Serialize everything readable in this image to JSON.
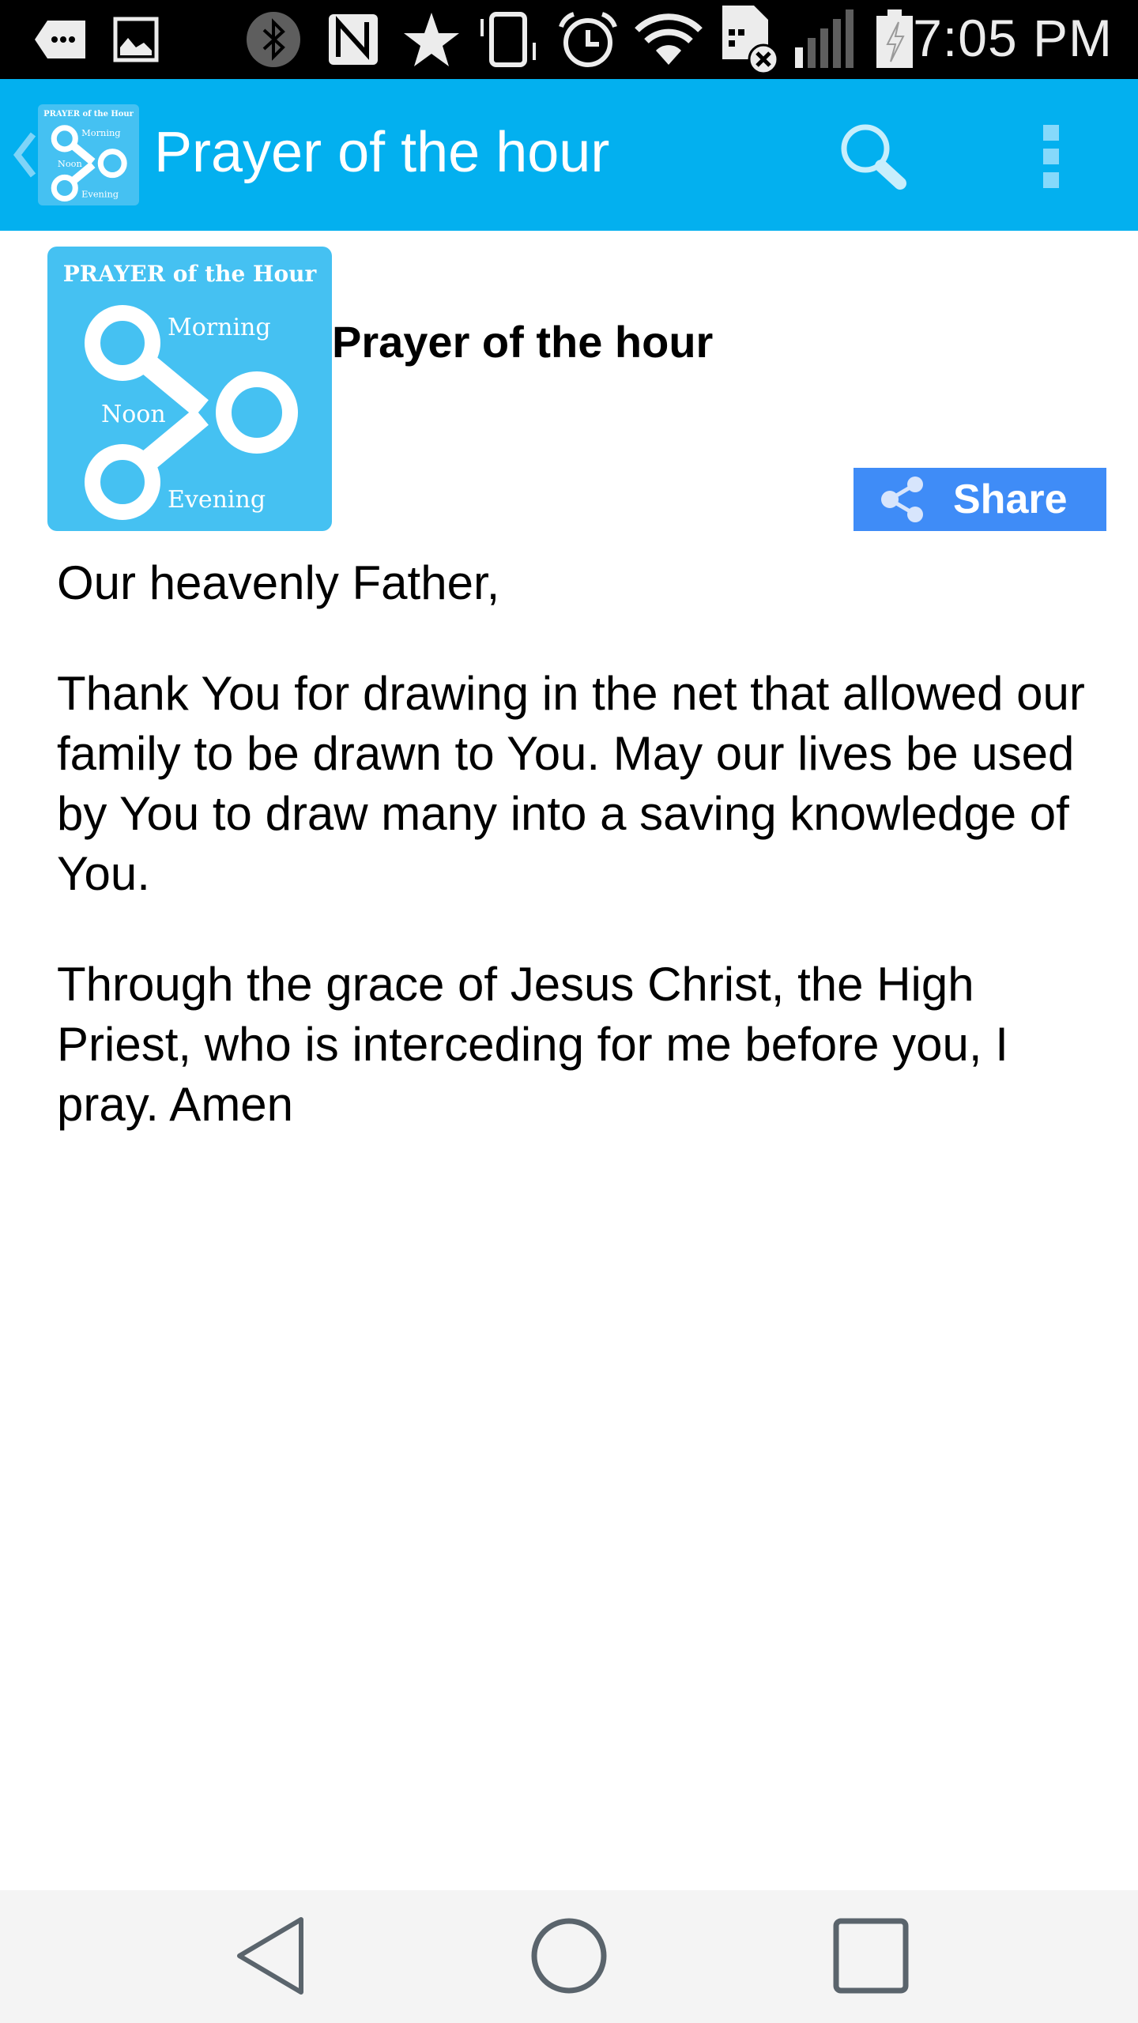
{
  "status_bar": {
    "time": "7:05 PM",
    "icons": [
      "message-icon",
      "image-icon",
      "bluetooth-icon",
      "nfc-icon",
      "star-icon",
      "vibrate-icon",
      "alarm-icon",
      "wifi-icon",
      "no-sim-icon",
      "signal-icon",
      "battery-charging-icon"
    ]
  },
  "app_bar": {
    "title": "Prayer of the hour",
    "back_icon": "chevron-left-icon",
    "search_icon": "search-icon",
    "overflow_icon": "more-vert-icon"
  },
  "logo": {
    "title": "PRAYER of the Hour",
    "labels": [
      "Morning",
      "Noon",
      "Evening"
    ]
  },
  "content": {
    "heading": "Prayer of the hour",
    "share_label": "Share",
    "paragraphs": [
      "Our heavenly Father,",
      "Thank You for drawing in the net that allowed our family to be drawn to You. May our lives be used by You to draw many into a saving knowledge of You.",
      "Through the grace of Jesus Christ, the High Priest, who is interceding for me before you, I pray. Amen"
    ]
  },
  "nav_bar": {
    "back": "back-icon",
    "home": "home-icon",
    "recents": "recents-icon"
  },
  "colors": {
    "app_bar": "#03b0ef",
    "logo_bg": "#45c1f2",
    "share_button": "#3f8cf7",
    "nav_bar": "#f4f4f4",
    "nav_icons": "#5a646c"
  }
}
